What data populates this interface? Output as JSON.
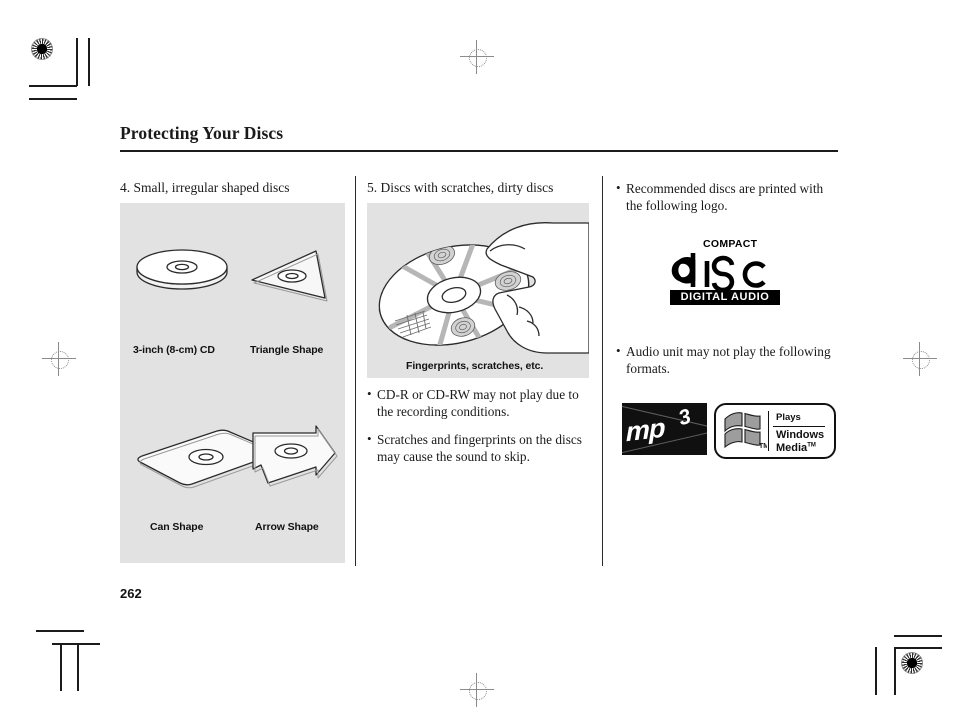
{
  "document": {
    "page_title": "Protecting Your Discs",
    "page_number": "262"
  },
  "columns": [
    {
      "heading": "4. Small, irregular shaped discs",
      "figure_captions": [
        "3-inch (8-cm) CD",
        "Triangle Shape",
        "Can Shape",
        "Arrow Shape"
      ]
    },
    {
      "heading": "5. Discs with scratches, dirty discs",
      "figure_caption": "Fingerprints, scratches, etc.",
      "bullets": [
        "CD-R or CD-RW may not play due to the recording conditions.",
        "Scratches and fingerprints on the discs may cause the sound to skip."
      ]
    },
    {
      "bullets": [
        "Recommended discs are printed with the following logo.",
        "Audio unit may not play the following formats."
      ],
      "logos": {
        "compact_disc": {
          "top_text": "COMPACT",
          "main_text": "disc",
          "bottom_text": "DIGITAL AUDIO"
        },
        "mp3": {
          "text": "mp",
          "superscript": "3"
        },
        "windows_media": {
          "line1": "Plays",
          "line2": "Windows",
          "line3": "Media",
          "trademark": "TM"
        }
      }
    }
  ],
  "colors": {
    "panel_background": "#e2e2e2",
    "text": "#1a1a1a",
    "rule": "#1b1b1b",
    "logo_black": "#101010"
  }
}
